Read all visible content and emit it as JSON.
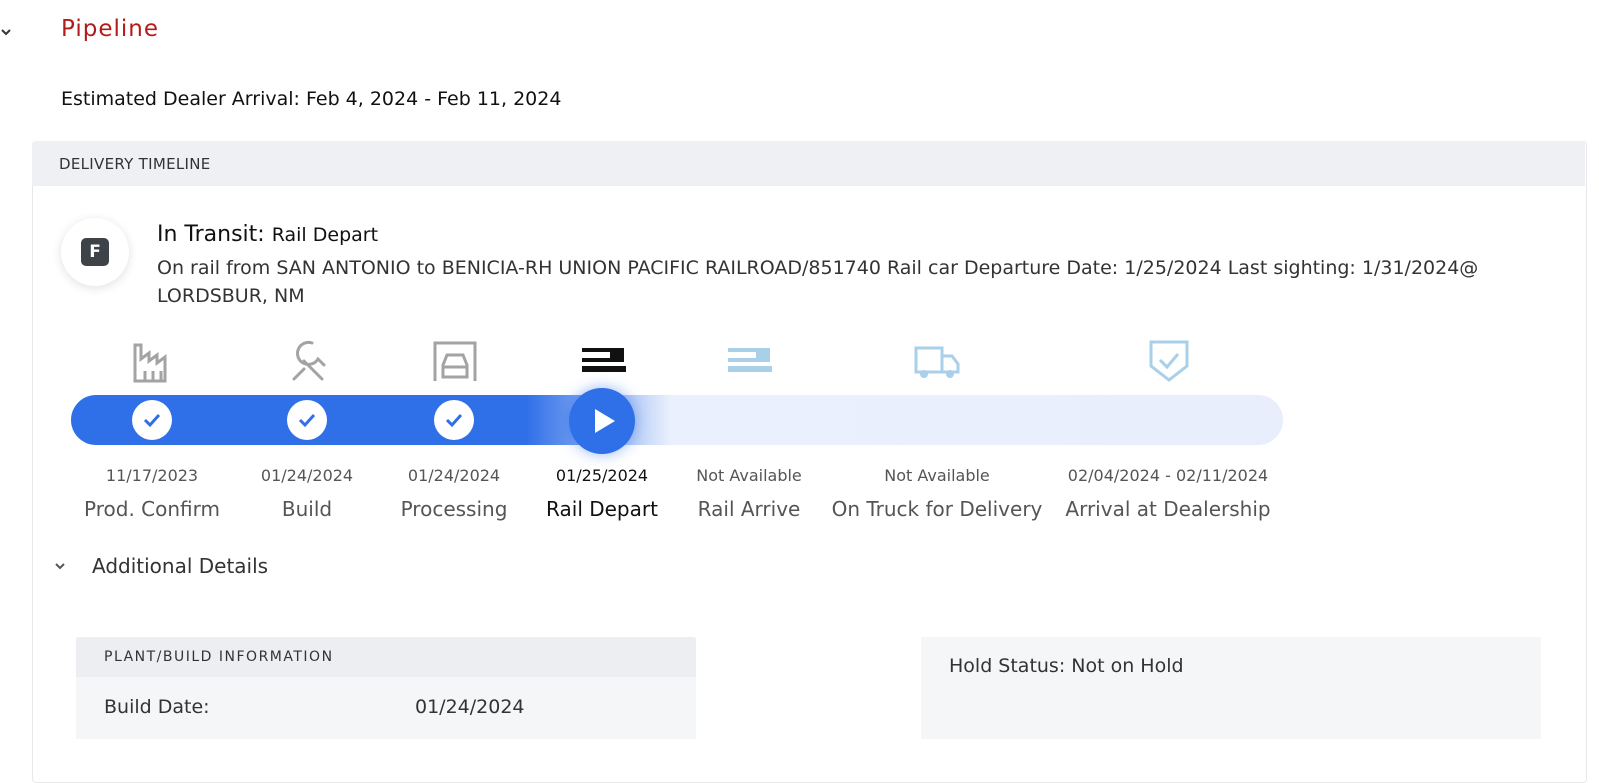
{
  "pipeline": {
    "title": "Pipeline",
    "eta_label": "Estimated Dealer Arrival:",
    "eta_value": "Feb 4, 2024 - Feb 11, 2024"
  },
  "timeline": {
    "header": "DELIVERY TIMELINE",
    "avatar_letter": "F",
    "status_label": "In Transit:",
    "status_value": "Rail Depart",
    "description": "On rail from SAN ANTONIO to BENICIA-RH UNION PACIFIC RAILROAD/851740 Rail car Departure Date: 1/25/2024 Last sighting: 1/31/2024@ LORDSBUR, NM",
    "stages": [
      {
        "label": "Prod. Confirm",
        "date": "11/17/2023",
        "state": "done",
        "icon": "factory-icon"
      },
      {
        "label": "Build",
        "date": "01/24/2024",
        "state": "done",
        "icon": "wrench-icon"
      },
      {
        "label": "Processing",
        "date": "01/24/2024",
        "state": "done",
        "icon": "garage-car-icon"
      },
      {
        "label": "Rail Depart",
        "date": "01/25/2024",
        "state": "current",
        "icon": "train-icon"
      },
      {
        "label": "Rail Arrive",
        "date": "Not Available",
        "state": "pending",
        "icon": "train-icon"
      },
      {
        "label": "On Truck for Delivery",
        "date": "Not Available",
        "state": "pending",
        "icon": "truck-icon"
      },
      {
        "label": "Arrival at Dealership",
        "date": "02/04/2024 - 02/11/2024",
        "state": "pending",
        "icon": "shield-check-icon"
      }
    ],
    "colors": {
      "progress": "#2f6fe8",
      "pending_icon": "#a9cfe9",
      "done_icon": "#a3a3a3",
      "title": "#b31b1b"
    }
  },
  "additional": {
    "title": "Additional Details",
    "plant_header": "PLANT/BUILD INFORMATION",
    "build_date_label": "Build Date:",
    "build_date_value": "01/24/2024",
    "hold_status": "Hold Status: Not on Hold"
  }
}
